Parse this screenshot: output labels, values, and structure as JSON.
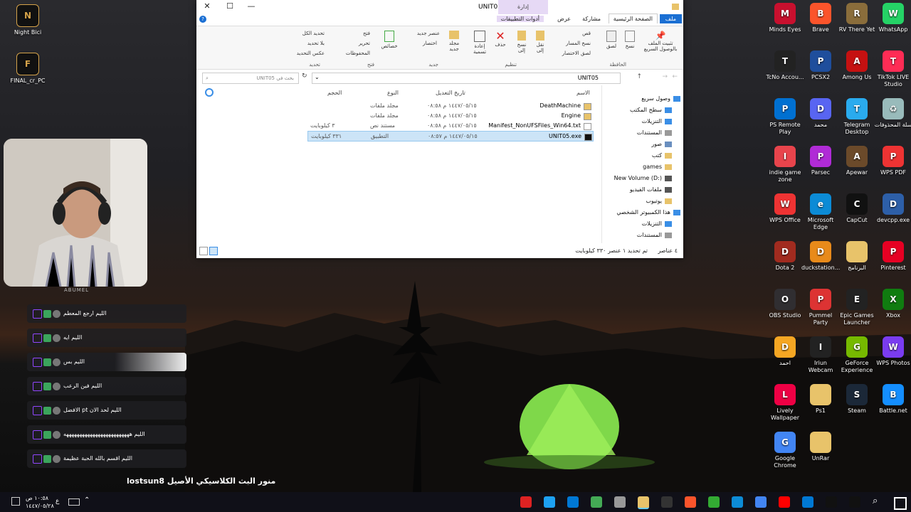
{
  "desktop_left": [
    {
      "label": "Night Bici",
      "icon": "app-icon-nightbici"
    },
    {
      "label": "FINAL_cr_PC",
      "icon": "app-icon-final"
    }
  ],
  "desktop_right": [
    {
      "label": "Minds Eyes",
      "icon": "minds-eyes-icon",
      "color": "#c8102e",
      "glyph": "M"
    },
    {
      "label": "Brave",
      "icon": "brave-icon",
      "color": "#fb542b",
      "glyph": "B"
    },
    {
      "label": "RV There Yet",
      "icon": "rv-icon",
      "color": "#8a6d3b",
      "glyph": "R"
    },
    {
      "label": "WhatsApp",
      "icon": "whatsapp-icon",
      "color": "#25d366",
      "glyph": "W"
    },
    {
      "label": "TcNo Accou...",
      "icon": "tcno-icon",
      "color": "#222",
      "glyph": "T"
    },
    {
      "label": "PCSX2",
      "icon": "pcsx2-icon",
      "color": "#1f4e9c",
      "glyph": "P"
    },
    {
      "label": "Among Us",
      "icon": "among-us-icon",
      "color": "#c51111",
      "glyph": "A"
    },
    {
      "label": "TikTok LIVE Studio",
      "icon": "tiktok-live-icon",
      "color": "#fe2c55",
      "glyph": "T"
    },
    {
      "label": "PS Remote Play",
      "icon": "ps-remote-icon",
      "color": "#0070d1",
      "glyph": "P"
    },
    {
      "label": "محمد",
      "icon": "discord-icon",
      "color": "#5865f2",
      "glyph": "D"
    },
    {
      "label": "Telegram Desktop",
      "icon": "telegram-icon",
      "color": "#2aabee",
      "glyph": "T"
    },
    {
      "label": "سلة المحذوفات",
      "icon": "recycle-bin-icon",
      "color": "#9bb",
      "glyph": "♻"
    },
    {
      "label": "indie game zone",
      "icon": "indie-game-icon",
      "color": "#e8444c",
      "glyph": "I"
    },
    {
      "label": "Parsec",
      "icon": "parsec-icon",
      "color": "#b02bd6",
      "glyph": "P"
    },
    {
      "label": "Apewar",
      "icon": "apewar-icon",
      "color": "#6b4a2a",
      "glyph": "A"
    },
    {
      "label": "WPS PDF",
      "icon": "wps-pdf-icon",
      "color": "#e33",
      "glyph": "P"
    },
    {
      "label": "WPS Office",
      "icon": "wps-office-icon",
      "color": "#e33",
      "glyph": "W"
    },
    {
      "label": "Microsoft Edge",
      "icon": "edge-icon",
      "color": "#0c8bd6",
      "glyph": "e"
    },
    {
      "label": "CapCut",
      "icon": "capcut-icon",
      "color": "#111",
      "glyph": "C"
    },
    {
      "label": "devcpp.exe",
      "icon": "devcpp-icon",
      "color": "#2d5fa8",
      "glyph": "D"
    },
    {
      "label": "Dota 2",
      "icon": "dota2-icon",
      "color": "#a12b1f",
      "glyph": "D"
    },
    {
      "label": "duckstation...",
      "icon": "duckstation-icon",
      "color": "#e88a1a",
      "glyph": "D"
    },
    {
      "label": "البرنامج",
      "icon": "folder-icon",
      "color": "#e8c36a",
      "glyph": ""
    },
    {
      "label": "Pinterest",
      "icon": "pinterest-icon",
      "color": "#e60023",
      "glyph": "P"
    },
    {
      "label": "OBS Studio",
      "icon": "obs-icon",
      "color": "#302e31",
      "glyph": "O"
    },
    {
      "label": "Pummel Party",
      "icon": "pummel-party-icon",
      "color": "#d33",
      "glyph": "P"
    },
    {
      "label": "Epic Games Launcher",
      "icon": "epic-games-icon",
      "color": "#222",
      "glyph": "E"
    },
    {
      "label": "Xbox",
      "icon": "xbox-icon",
      "color": "#107c10",
      "glyph": "X"
    },
    {
      "label": "احمد",
      "icon": "discord-icon",
      "color": "#f5a623",
      "glyph": "D"
    },
    {
      "label": "Iriun Webcam",
      "icon": "iriun-icon",
      "color": "#222",
      "glyph": "I"
    },
    {
      "label": "GeForce Experience",
      "icon": "geforce-icon",
      "color": "#76b900",
      "glyph": "G"
    },
    {
      "label": "WPS Photos",
      "icon": "wps-photos-icon",
      "color": "#7a3cf0",
      "glyph": "W"
    },
    {
      "label": "Lively Wallpaper",
      "icon": "lively-icon",
      "color": "#e04",
      "glyph": "L"
    },
    {
      "label": "Ps1",
      "icon": "folder-icon",
      "color": "#e8c36a",
      "glyph": ""
    },
    {
      "label": "Steam",
      "icon": "steam-icon",
      "color": "#1b2838",
      "glyph": "S"
    },
    {
      "label": "Battle.net",
      "icon": "battlenet-icon",
      "color": "#148eff",
      "glyph": "B"
    },
    {
      "label": "Google Chrome",
      "icon": "chrome-icon",
      "color": "#4285f4",
      "glyph": "G"
    },
    {
      "label": "UnRar",
      "icon": "folder-icon",
      "color": "#e8c36a",
      "glyph": ""
    }
  ],
  "explorer": {
    "title": "UNIT05",
    "manage_label": "إدارة",
    "app_tools": "أدوات التطبيقات",
    "tabs": {
      "file": "ملف",
      "home": "الصفحة الرئيسية",
      "share": "مشاركة",
      "view": "عرض"
    },
    "ribbon": {
      "pin": "تثبيت الملف بالوصول السريع",
      "copy": "نسخ",
      "paste": "لصق",
      "cut": "قص",
      "copy_path": "نسخ المسار",
      "paste_shortcut": "لصق الاختصار",
      "move_to": "نقل إلى",
      "copy_to": "نسخ إلى",
      "delete": "حذف",
      "rename": "إعادة تسمية",
      "new_folder": "مجلد جديد",
      "new_item": "عنصر جديد",
      "easy_access": "اختصار",
      "properties": "خصائص",
      "open": "فتح",
      "edit": "تحرير",
      "history": "المحفوظات",
      "select_all": "تحديد الكل",
      "select_none": "بلا تحديد",
      "invert": "عكس التحديد",
      "g_clipboard": "الحافظة",
      "g_organize": "تنظيم",
      "g_new": "جديد",
      "g_open": "فتح",
      "g_select": "تحديد"
    },
    "address": "UNIT05",
    "search_placeholder": "بحث في UNIT05",
    "columns": {
      "name": "الاسم",
      "date": "تاريخ التعديل",
      "type": "النوع",
      "size": "الحجم"
    },
    "files": [
      {
        "name": "DeathMachine",
        "date": "١٤٤٧/٠٥/١٥ م ٠٨:٥٨",
        "type": "مجلد ملفات",
        "size": ""
      },
      {
        "name": "Engine",
        "date": "١٤٤٧/٠٥/١٥ م ٠٨:٥٨",
        "type": "مجلد ملفات",
        "size": ""
      },
      {
        "name": "Manifest_NonUFSFiles_Win64.txt",
        "date": "١٤٤٧/٠٥/١٥ م ٠٨:٥٨",
        "type": "مستند نص",
        "size": "٣ كيلوبايت"
      },
      {
        "name": "UNIT05.exe",
        "date": "١٤٤٧/٠٥/١٥ م ٠٨:٥٧",
        "type": "التطبيق",
        "size": "٣٣١ كيلوبايت"
      }
    ],
    "nav": [
      {
        "label": "وصول سريع",
        "icon": "star-icon"
      },
      {
        "label": "سطح المكتب",
        "icon": "desktop-icon"
      },
      {
        "label": "التنزيلات",
        "icon": "download-icon"
      },
      {
        "label": "المستندات",
        "icon": "document-icon"
      },
      {
        "label": "صور",
        "icon": "pictures-icon"
      },
      {
        "label": "كتب",
        "icon": "folder-icon"
      },
      {
        "label": "games",
        "icon": "folder-icon"
      },
      {
        "label": "New Volume (D:)",
        "icon": "drive-icon"
      },
      {
        "label": "ملفات الفيديو",
        "icon": "video-icon"
      },
      {
        "label": "يوتيوب",
        "icon": "folder-icon"
      },
      {
        "label": "هذا الكمبيوتر الشخصي",
        "icon": "computer-icon"
      },
      {
        "label": "التنزيلات",
        "icon": "download-icon"
      },
      {
        "label": "المستندات",
        "icon": "document-icon"
      }
    ],
    "status": {
      "count": "٤ عناصر",
      "selected": "تم تحديد ١ عنصر  ٣٣٠ كيلوبايت"
    }
  },
  "webcam": {
    "caption": "ABUMEL"
  },
  "chat": [
    {
      "text": "الليم ارجع المعطم"
    },
    {
      "text": "الليم ايه"
    },
    {
      "text": "الليم بس"
    },
    {
      "text": "الليم فين الرعب"
    },
    {
      "text": "الليم لحد الان pt الافضل"
    },
    {
      "text": "الليم هههههههههههههههههههههههههه"
    },
    {
      "text": "الليم اقسم بالله الحبة عظيمة"
    }
  ],
  "overlay_text": "منور البث الكلاسيكي الأصيل lostsun8",
  "taskbar": {
    "time": "١٠:٥٨ ص",
    "date": "١٤٤٧/٠٥/٢٨",
    "lang": "ع"
  }
}
